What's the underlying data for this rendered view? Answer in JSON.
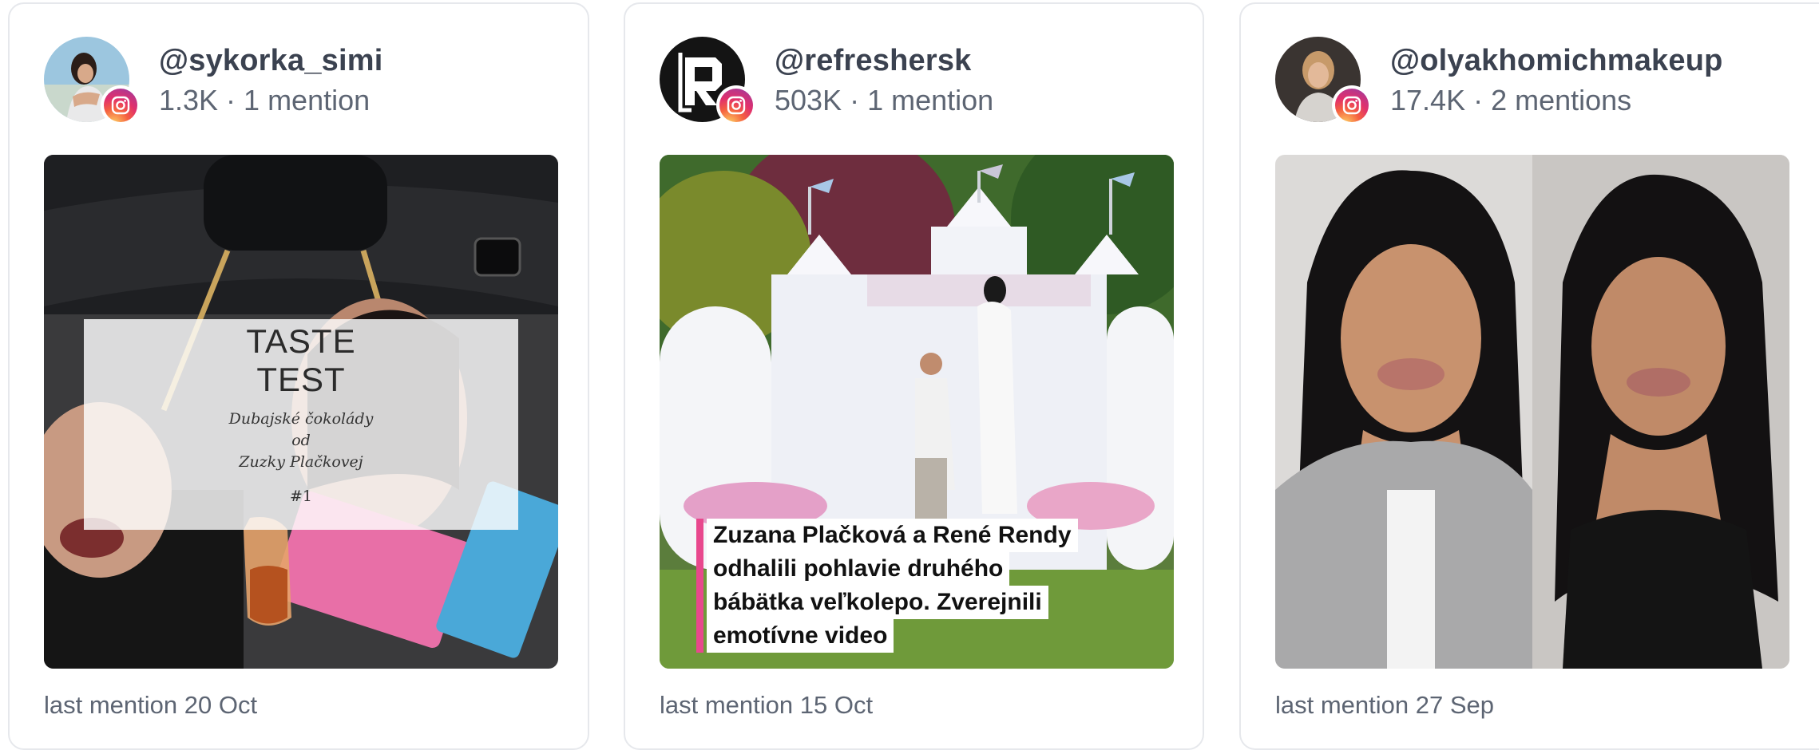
{
  "cards": [
    {
      "handle": "@sykorka_simi",
      "stats": "1.3K · 1 mention",
      "platform_icon": "instagram-icon",
      "overlay": {
        "title": "TASTE\nTEST",
        "subtitle": "Dubajské čokolády\nod\nZuzky Plačkovej",
        "number": "#1"
      },
      "footer": "last mention 20 Oct"
    },
    {
      "handle": "@refreshersk",
      "stats": "503K · 1 mention",
      "platform_icon": "instagram-icon",
      "caption": [
        "Zuzana Plačková a René Rendy",
        "odhalili pohlavie druhého",
        "bábätka veľkolepo. Zverejnili",
        "emotívne video"
      ],
      "footer": "last mention 15 Oct"
    },
    {
      "handle": "@olyakhomichmakeup",
      "stats": "17.4K · 2 mentions",
      "platform_icon": "instagram-icon",
      "footer": "last mention 27 Sep"
    }
  ],
  "colors": {
    "accent_pink": "#e8488d",
    "text_dark": "#3b4250",
    "text_muted": "#5d6573",
    "card_border": "#e6e8ec"
  }
}
